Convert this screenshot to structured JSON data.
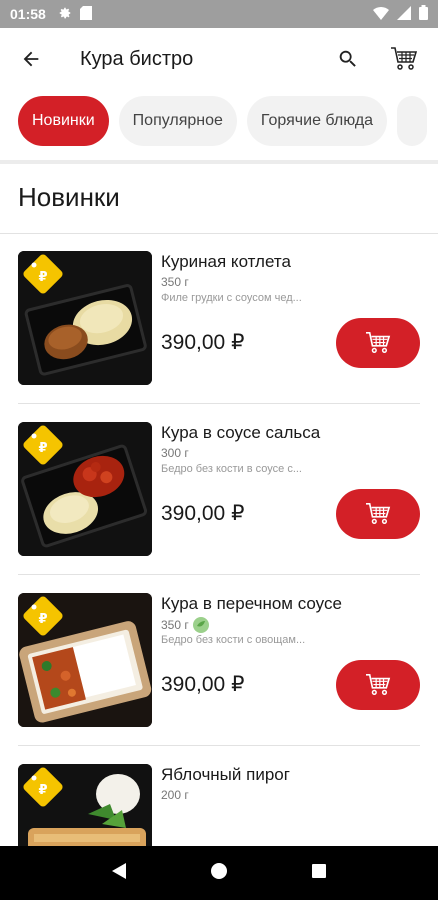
{
  "status_bar": {
    "time": "01:58"
  },
  "app_bar": {
    "title": "Кура бистро"
  },
  "categories": [
    {
      "label": "Новинки",
      "active": true
    },
    {
      "label": "Популярное",
      "active": false
    },
    {
      "label": "Горячие блюда",
      "active": false
    }
  ],
  "section_title": "Новинки",
  "items": [
    {
      "name": "Куриная котлета",
      "weight": "350 г",
      "description": "Филе грудки с соусом чед...",
      "price": "390,00 ₽",
      "icon": "cutlet-with-mashed-potatoes"
    },
    {
      "name": "Кура в соусе сальса",
      "weight": "300 г",
      "description": "Бедро без кости в соусе с...",
      "price": "390,00 ₽",
      "icon": "chicken-salsa-with-mash"
    },
    {
      "name": "Кура в перечном соусе",
      "weight": "350 г",
      "description": "Бедро без кости с овощам...",
      "price": "390,00 ₽",
      "icon": "chicken-pepper-sauce-with-rice",
      "eco_badge": true
    },
    {
      "name": "Яблочный пирог",
      "weight": "200 г",
      "description": "",
      "price": "",
      "icon": "apple-pie"
    }
  ],
  "colors": {
    "accent": "#d32027",
    "badge": "#f5c400",
    "status_bar": "#9e9e9e"
  }
}
